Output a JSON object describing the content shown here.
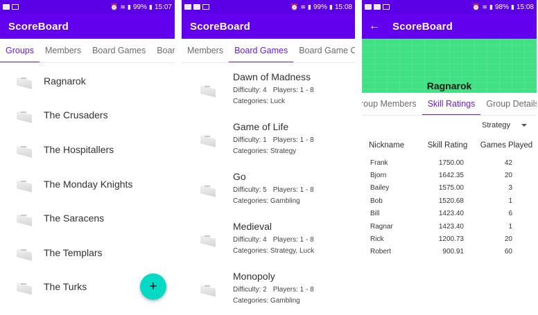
{
  "colors": {
    "status_bar": "#5b00e6",
    "app_bar": "#6200ee",
    "accent": "#6a1be6",
    "fab": "#03dac5",
    "banner": "#41e085"
  },
  "screens": [
    {
      "status": {
        "battery": "99%",
        "time": "15:07"
      },
      "app_title": "ScoreBoard",
      "tabs": [
        {
          "label": "Groups",
          "active": true
        },
        {
          "label": "Members",
          "active": false
        },
        {
          "label": "Board Games",
          "active": false
        },
        {
          "label": "Board",
          "active": false
        }
      ],
      "groups": [
        {
          "name": "Ragnarok"
        },
        {
          "name": "The Crusaders"
        },
        {
          "name": "The Hospitallers"
        },
        {
          "name": "The Monday Knights"
        },
        {
          "name": "The Saracens"
        },
        {
          "name": "The Templars"
        },
        {
          "name": "The Turks"
        }
      ],
      "fab_label": "+"
    },
    {
      "status": {
        "battery": "99%",
        "time": "15:08"
      },
      "app_title": "ScoreBoard",
      "tabs": [
        {
          "label": "Members",
          "active": false
        },
        {
          "label": "Board Games",
          "active": true
        },
        {
          "label": "Board Game Ca",
          "active": false
        }
      ],
      "difficulty_label": "Difficulty:",
      "players_label": "Players:",
      "categories_label": "Categories:",
      "board_games": [
        {
          "name": "Dawn of Madness",
          "difficulty": "4",
          "players": "1 - 8",
          "categories": "Luck"
        },
        {
          "name": "Game of Life",
          "difficulty": "1",
          "players": "1 - 8",
          "categories": "Strategy"
        },
        {
          "name": "Go",
          "difficulty": "5",
          "players": "1 - 8",
          "categories": "Gambling"
        },
        {
          "name": "Medieval",
          "difficulty": "4",
          "players": "1 - 8",
          "categories": "Strategy, Luck"
        },
        {
          "name": "Monopoly",
          "difficulty": "2",
          "players": "1 - 8",
          "categories": "Gambling"
        }
      ],
      "fab_label": "+"
    },
    {
      "status": {
        "battery": "98%",
        "time": "15:08"
      },
      "app_title": "ScoreBoard",
      "back_icon": "arrow-left-icon",
      "group_title": "Ragnarok",
      "tabs": [
        {
          "label": "roup Members",
          "active": false
        },
        {
          "label": "Skill Ratings",
          "active": true
        },
        {
          "label": "Group Details",
          "active": false
        }
      ],
      "category_select": "Strategy",
      "table": {
        "headers": {
          "nickname": "Nickname",
          "rating": "Skill Rating",
          "games": "Games Played"
        },
        "rows": [
          {
            "nickname": "Frank",
            "rating": "1750.00",
            "games": "42"
          },
          {
            "nickname": "Bjorn",
            "rating": "1642.35",
            "games": "20"
          },
          {
            "nickname": "Bailey",
            "rating": "1575.00",
            "games": "3"
          },
          {
            "nickname": "Bob",
            "rating": "1520.68",
            "games": "1"
          },
          {
            "nickname": "Bill",
            "rating": "1423.40",
            "games": "6"
          },
          {
            "nickname": "Ragnar",
            "rating": "1423.40",
            "games": "1"
          },
          {
            "nickname": "Rick",
            "rating": "1200.73",
            "games": "20"
          },
          {
            "nickname": "Robert",
            "rating": "900.91",
            "games": "60"
          }
        ]
      }
    }
  ]
}
